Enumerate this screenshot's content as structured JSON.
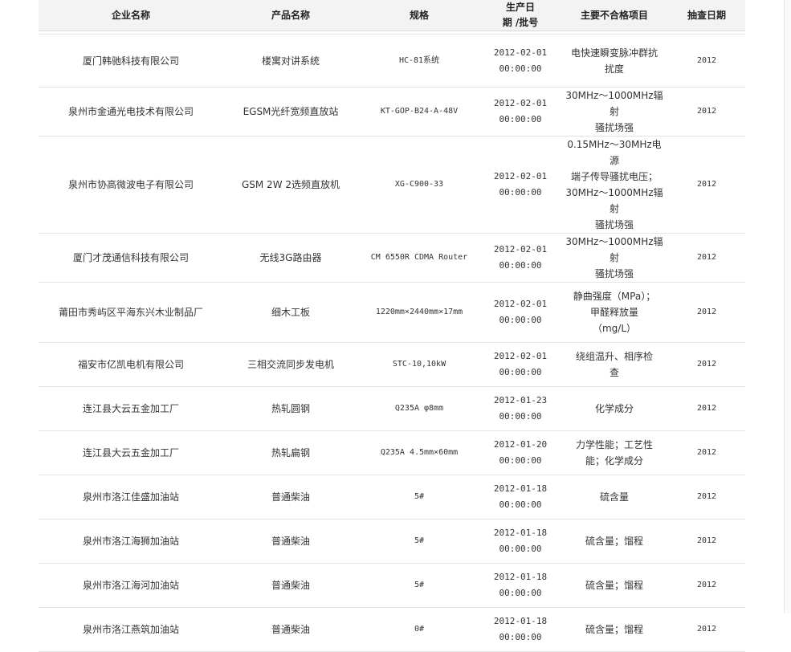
{
  "columns": {
    "company": "企业名称",
    "product": "产品名称",
    "spec": "规格",
    "date_line1": "生产日",
    "date_line2": "期 /批号",
    "issue": "主要不合格项目",
    "check_date": "抽查日期"
  },
  "rows": [
    {
      "company": "厦门韩驰科技有限公司",
      "product": "楼寓对讲系统",
      "spec": "HC-81系统",
      "date1": "2012-02-01",
      "date2": "00:00:00",
      "issue": [
        "电快速瞬变脉冲群抗",
        "扰度"
      ],
      "check": "2012"
    },
    {
      "company": "泉州市金通光电技术有限公司",
      "product": "EGSM光纤宽频直放站",
      "spec": "KT-GOP-B24-A-48V",
      "date1": "2012-02-01",
      "date2": "00:00:00",
      "issue": [
        "30MHz～1000MHz辐射",
        "骚扰场强"
      ],
      "check": "2012"
    },
    {
      "company": "泉州市协高微波电子有限公司",
      "product": "GSM 2W 2选频直放机",
      "spec": "XG-C900-33",
      "date1": "2012-02-01",
      "date2": "00:00:00",
      "issue": [
        "0.15MHz～30MHz电源",
        "端子传导骚扰电压；",
        "30MHz～1000MHz辐射",
        "骚扰场强"
      ],
      "check": "2012"
    },
    {
      "company": "厦门才茂通信科技有限公司",
      "product": "无线3G路由器",
      "spec": "CM 6550R CDMA Router",
      "date1": "2012-02-01",
      "date2": "00:00:00",
      "issue": [
        "30MHz～1000MHz辐射",
        "骚扰场强"
      ],
      "check": "2012"
    },
    {
      "company": "莆田市秀屿区平海东兴木业制品厂",
      "product": "细木工板",
      "spec": "1220mm×2440mm×17mm",
      "date1": "2012-02-01",
      "date2": "00:00:00",
      "issue": [
        "静曲强度（MPa）；",
        "甲醛释放量",
        "（mg/L）"
      ],
      "check": "2012"
    },
    {
      "company": "福安市亿凯电机有限公司",
      "product": "三相交流同步发电机",
      "spec": "STC-10,10kW",
      "date1": "2012-02-01",
      "date2": "00:00:00",
      "issue": [
        "绕组温升、相序检",
        "查"
      ],
      "check": "2012"
    },
    {
      "company": "连江县大云五金加工厂",
      "product": "热轧圆钢",
      "spec": "Q235A φ8mm",
      "date1": "2012-01-23",
      "date2": "00:00:00",
      "issue": [
        "化学成分"
      ],
      "check": "2012"
    },
    {
      "company": "连江县大云五金加工厂",
      "product": "热轧扁钢",
      "spec": "Q235A 4.5mm×60mm",
      "date1": "2012-01-20",
      "date2": "00:00:00",
      "issue": [
        "力学性能；工艺性",
        "能；化学成分"
      ],
      "check": "2012"
    },
    {
      "company": "泉州市洛江佳盛加油站",
      "product": "普通柴油",
      "spec": "5#",
      "date1": "2012-01-18",
      "date2": "00:00:00",
      "issue": [
        "硫含量"
      ],
      "check": "2012"
    },
    {
      "company": "泉州市洛江海狮加油站",
      "product": "普通柴油",
      "spec": "5#",
      "date1": "2012-01-18",
      "date2": "00:00:00",
      "issue": [
        "硫含量；馏程"
      ],
      "check": "2012"
    },
    {
      "company": "泉州市洛江海河加油站",
      "product": "普通柴油",
      "spec": "5#",
      "date1": "2012-01-18",
      "date2": "00:00:00",
      "issue": [
        "硫含量；馏程"
      ],
      "check": "2012"
    },
    {
      "company": "泉州市洛江燕筑加油站",
      "product": "普通柴油",
      "spec": "0#",
      "date1": "2012-01-18",
      "date2": "00:00:00",
      "issue": [
        "硫含量；馏程"
      ],
      "check": "2012"
    }
  ]
}
